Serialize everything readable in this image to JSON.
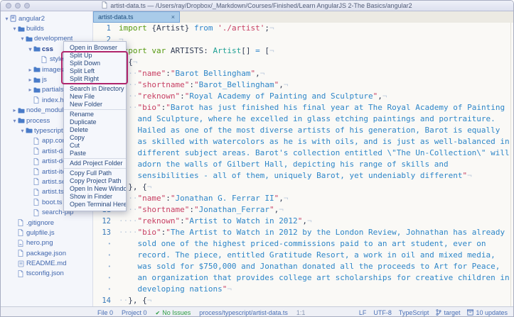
{
  "window": {
    "title": "artist-data.ts — /Users/ray/Dropbox/_Markdown/Courses/Finished/Learn AngularJS 2-The Basics/angular2"
  },
  "colors": {
    "annotation_box": "#b0246b",
    "active_tab": "#a9cbe9",
    "no_issues_green": "#2f9e44",
    "keyword_green": "#55990f",
    "keyword_blue": "#2f86cc",
    "string_red": "#c73f63",
    "value_blue": "#2e86c8",
    "type_teal": "#1fa094"
  },
  "sidebar": {
    "items": [
      {
        "label": "angular2",
        "level": 0,
        "icon": "repo",
        "chevron": "down",
        "selected": false
      },
      {
        "label": "builds",
        "level": 1,
        "icon": "folder",
        "chevron": "down",
        "selected": false
      },
      {
        "label": "development",
        "level": 2,
        "icon": "folder",
        "chevron": "down",
        "selected": false
      },
      {
        "label": "css",
        "level": 3,
        "icon": "folder",
        "chevron": "down",
        "selected": true
      },
      {
        "label": "style.css",
        "level": 4,
        "icon": "file",
        "chevron": "none",
        "selected": false
      },
      {
        "label": "images",
        "level": 3,
        "icon": "folder",
        "chevron": "right",
        "selected": false
      },
      {
        "label": "js",
        "level": 3,
        "icon": "folder",
        "chevron": "right",
        "selected": false
      },
      {
        "label": "partials",
        "level": 3,
        "icon": "folder",
        "chevron": "right",
        "selected": false
      },
      {
        "label": "index.html",
        "level": 3,
        "icon": "file",
        "chevron": "none",
        "selected": false
      },
      {
        "label": "node_modules",
        "level": 1,
        "icon": "folder",
        "chevron": "right",
        "selected": false
      },
      {
        "label": "process",
        "level": 1,
        "icon": "folder",
        "chevron": "down",
        "selected": false
      },
      {
        "label": "typescript",
        "level": 2,
        "icon": "folder",
        "chevron": "down",
        "selected": false
      },
      {
        "label": "app.compo",
        "level": 3,
        "icon": "file",
        "chevron": "none",
        "selected": false
      },
      {
        "label": "artist-data.",
        "level": 3,
        "icon": "file",
        "chevron": "none",
        "selected": false
      },
      {
        "label": "artist-detai",
        "level": 3,
        "icon": "file",
        "chevron": "none",
        "selected": false
      },
      {
        "label": "artist-item.",
        "level": 3,
        "icon": "file",
        "chevron": "none",
        "selected": false
      },
      {
        "label": "artist.servic",
        "level": 3,
        "icon": "file",
        "chevron": "none",
        "selected": false
      },
      {
        "label": "artist.ts",
        "level": 3,
        "icon": "file",
        "chevron": "none",
        "selected": false
      },
      {
        "label": "boot.ts",
        "level": 3,
        "icon": "file",
        "chevron": "none",
        "selected": false
      },
      {
        "label": "search-pip",
        "level": 3,
        "icon": "file",
        "chevron": "none",
        "selected": false
      },
      {
        "label": ".gitignore",
        "level": 1,
        "icon": "file",
        "chevron": "none",
        "selected": false
      },
      {
        "label": "gulpfile.js",
        "level": 1,
        "icon": "file",
        "chevron": "none",
        "selected": false
      },
      {
        "label": "hero.png",
        "level": 1,
        "icon": "image",
        "chevron": "none",
        "selected": false
      },
      {
        "label": "package.json",
        "level": 1,
        "icon": "file",
        "chevron": "none",
        "selected": false
      },
      {
        "label": "README.md",
        "level": 1,
        "icon": "book",
        "chevron": "none",
        "selected": false
      },
      {
        "label": "tsconfig.json",
        "level": 1,
        "icon": "file",
        "chevron": "none",
        "selected": false
      }
    ]
  },
  "editor": {
    "tab": {
      "label": "artist-data.ts",
      "close": "×"
    }
  },
  "code": {
    "rows": [
      {
        "gutter": "1",
        "wrap": false,
        "segments": [
          [
            "g",
            "import"
          ],
          [
            "p",
            " {Artist} "
          ],
          [
            "b",
            "from"
          ],
          [
            "r",
            " './artist'"
          ],
          [
            "p",
            ";"
          ],
          [
            "i",
            "¬"
          ]
        ]
      },
      {
        "gutter": "2",
        "wrap": false,
        "segments": [
          [
            "i",
            "¬"
          ]
        ]
      },
      {
        "gutter": "3",
        "wrap": false,
        "segments": [
          [
            "g",
            "export var"
          ],
          [
            "p",
            " ARTISTS: "
          ],
          [
            "t",
            "Artist"
          ],
          [
            "p",
            "[] "
          ],
          [
            "b",
            "="
          ],
          [
            "p",
            " ["
          ],
          [
            "i",
            "¬"
          ]
        ]
      },
      {
        "gutter": "4",
        "wrap": false,
        "segments": [
          [
            "i",
            "··"
          ],
          [
            "p",
            "{"
          ],
          [
            "i",
            "¬"
          ]
        ]
      },
      {
        "gutter": "5",
        "wrap": false,
        "segments": [
          [
            "i",
            "····"
          ],
          [
            "r",
            "\"name\""
          ],
          [
            "p",
            ":"
          ],
          [
            "r",
            "\""
          ],
          [
            "v",
            "Barot Bellingham"
          ],
          [
            "r",
            "\""
          ],
          [
            "p",
            ","
          ],
          [
            "i",
            "¬"
          ]
        ]
      },
      {
        "gutter": "6",
        "wrap": false,
        "segments": [
          [
            "i",
            "····"
          ],
          [
            "r",
            "\"shortname\""
          ],
          [
            "p",
            ":"
          ],
          [
            "r",
            "\""
          ],
          [
            "v",
            "Barot_Bellingham"
          ],
          [
            "r",
            "\""
          ],
          [
            "p",
            ","
          ],
          [
            "i",
            "¬"
          ]
        ]
      },
      {
        "gutter": "7",
        "wrap": false,
        "segments": [
          [
            "i",
            "····"
          ],
          [
            "r",
            "\"reknown\""
          ],
          [
            "p",
            ":"
          ],
          [
            "r",
            "\""
          ],
          [
            "v",
            "Royal Academy of Painting and Sculpture"
          ],
          [
            "r",
            "\""
          ],
          [
            "p",
            ","
          ],
          [
            "i",
            "¬"
          ]
        ]
      },
      {
        "gutter": "8",
        "wrap": false,
        "segments": [
          [
            "i",
            "····"
          ],
          [
            "r",
            "\"bio\""
          ],
          [
            "p",
            ":"
          ],
          [
            "r",
            "\""
          ],
          [
            "v",
            "Barot has just finished his final year at The Royal Academy of Painting"
          ]
        ]
      },
      {
        "gutter": "•",
        "wrap": true,
        "segments": [
          [
            "v",
            "and Sculpture, where he excelled in glass etching paintings and portraiture."
          ]
        ]
      },
      {
        "gutter": "•",
        "wrap": true,
        "segments": [
          [
            "v",
            "Hailed as one of the most diverse artists of his generation, Barot is equally"
          ]
        ]
      },
      {
        "gutter": "•",
        "wrap": true,
        "segments": [
          [
            "v",
            "as skilled with watercolors as he is with oils, and is just as well-balanced in"
          ]
        ]
      },
      {
        "gutter": "•",
        "wrap": true,
        "segments": [
          [
            "v",
            "different subject areas. Barot's collection entitled \\\"The Un-Collection\\\" will"
          ]
        ]
      },
      {
        "gutter": "•",
        "wrap": true,
        "segments": [
          [
            "v",
            "adorn the walls of Gilbert Hall, depicting his range of skills and"
          ]
        ]
      },
      {
        "gutter": "•",
        "wrap": true,
        "segments": [
          [
            "v",
            "sensibilities - all of them, uniquely Barot, yet undeniably different"
          ],
          [
            "r",
            "\""
          ],
          [
            "i",
            "¬"
          ]
        ]
      },
      {
        "gutter": "9",
        "wrap": false,
        "segments": [
          [
            "i",
            "··"
          ],
          [
            "p",
            "}, {"
          ],
          [
            "i",
            "¬"
          ]
        ]
      },
      {
        "gutter": "10",
        "wrap": false,
        "segments": [
          [
            "i",
            "····"
          ],
          [
            "r",
            "\"name\""
          ],
          [
            "p",
            ":"
          ],
          [
            "r",
            "\""
          ],
          [
            "v",
            "Jonathan G. Ferrar II"
          ],
          [
            "r",
            "\""
          ],
          [
            "p",
            ","
          ],
          [
            "i",
            "¬"
          ]
        ]
      },
      {
        "gutter": "11",
        "wrap": false,
        "segments": [
          [
            "i",
            "····"
          ],
          [
            "r",
            "\"shortname\""
          ],
          [
            "p",
            ":"
          ],
          [
            "r",
            "\""
          ],
          [
            "v",
            "Jonathan_Ferrar"
          ],
          [
            "r",
            "\""
          ],
          [
            "p",
            ","
          ],
          [
            "i",
            "¬"
          ]
        ]
      },
      {
        "gutter": "12",
        "wrap": false,
        "segments": [
          [
            "i",
            "····"
          ],
          [
            "r",
            "\"reknown\""
          ],
          [
            "p",
            ":"
          ],
          [
            "r",
            "\""
          ],
          [
            "v",
            "Artist to Watch in 2012"
          ],
          [
            "r",
            "\""
          ],
          [
            "p",
            ","
          ],
          [
            "i",
            "¬"
          ]
        ]
      },
      {
        "gutter": "13",
        "wrap": false,
        "segments": [
          [
            "i",
            "····"
          ],
          [
            "r",
            "\"bio\""
          ],
          [
            "p",
            ":"
          ],
          [
            "r",
            "\""
          ],
          [
            "v",
            "The Artist to Watch in 2012 by the London Review, Johnathan has already"
          ]
        ]
      },
      {
        "gutter": "•",
        "wrap": true,
        "segments": [
          [
            "v",
            "sold one of the highest priced-commissions paid to an art student, ever on"
          ]
        ]
      },
      {
        "gutter": "•",
        "wrap": true,
        "segments": [
          [
            "v",
            "record. The piece, entitled Gratitude Resort, a work in oil and mixed media,"
          ]
        ]
      },
      {
        "gutter": "•",
        "wrap": true,
        "segments": [
          [
            "v",
            "was sold for $750,000 and Jonathan donated all the proceeds to Art for Peace,"
          ]
        ]
      },
      {
        "gutter": "•",
        "wrap": true,
        "segments": [
          [
            "v",
            "an organization that provides college art scholarships for creative children in"
          ]
        ]
      },
      {
        "gutter": "•",
        "wrap": true,
        "segments": [
          [
            "v",
            "developing nations"
          ],
          [
            "r",
            "\""
          ],
          [
            "i",
            "¬"
          ]
        ]
      },
      {
        "gutter": "14",
        "wrap": false,
        "segments": [
          [
            "i",
            "··"
          ],
          [
            "p",
            "}, {"
          ],
          [
            "i",
            "¬"
          ]
        ]
      }
    ]
  },
  "context_menu": {
    "groups": [
      [
        "Open in Browser",
        "Split Up",
        "Split Down",
        "Split Left",
        "Split Right"
      ],
      [
        "Search in Directory",
        "New File",
        "New Folder"
      ],
      [
        "Rename",
        "Duplicate",
        "Delete",
        "Copy",
        "Cut",
        "Paste"
      ],
      [
        "Add Project Folder"
      ],
      [
        "Copy Full Path",
        "Copy Project Path",
        "Open In New Window",
        "Show in Finder",
        "Open Terminal Here"
      ]
    ],
    "highlighted_items": [
      "Split Up",
      "Split Down",
      "Split Left",
      "Split Right"
    ]
  },
  "statusbar": {
    "left": [
      {
        "label": "File 0"
      },
      {
        "label": "Project 0"
      },
      {
        "label": "No Issues",
        "icon": "check",
        "style": "ok"
      },
      {
        "label": "process/typescript/artist-data.ts"
      },
      {
        "label": "1:1",
        "style": "dim"
      }
    ],
    "right": [
      {
        "label": "LF"
      },
      {
        "label": "UTF-8"
      },
      {
        "label": "TypeScript"
      },
      {
        "label": "target",
        "icon": "branch"
      },
      {
        "label": "10 updates",
        "icon": "package"
      }
    ]
  }
}
